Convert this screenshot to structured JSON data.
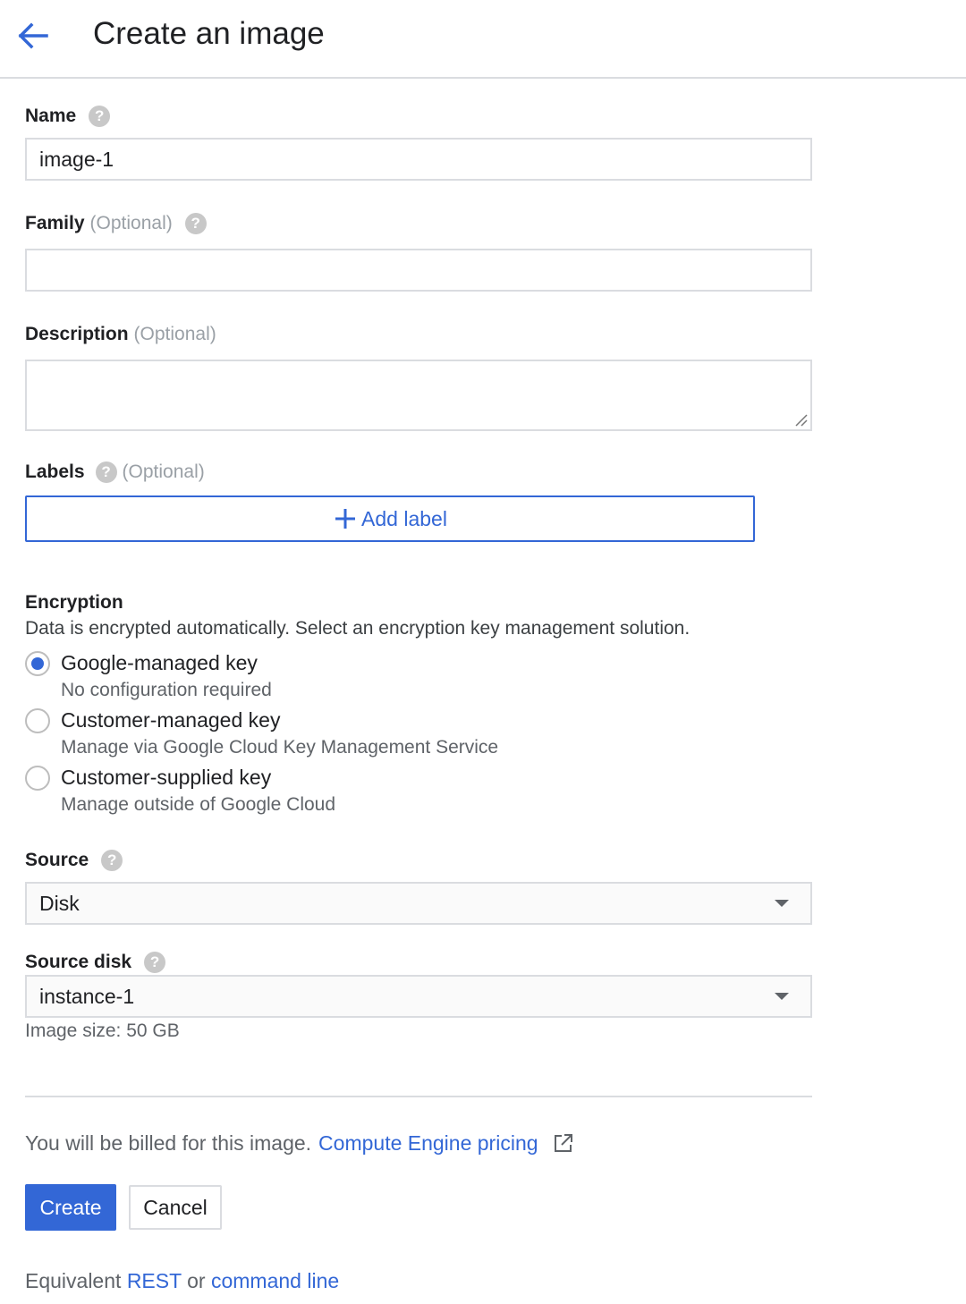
{
  "header": {
    "title": "Create an image",
    "back_icon": "arrow-back-icon"
  },
  "form": {
    "name": {
      "label": "Name",
      "value": "image-1"
    },
    "family": {
      "label": "Family",
      "optional": "(Optional)",
      "value": ""
    },
    "description": {
      "label": "Description",
      "optional": "(Optional)",
      "value": ""
    },
    "labels": {
      "label": "Labels",
      "optional": "(Optional)",
      "add_button": "Add label"
    },
    "help_glyph": "?",
    "encryption": {
      "title": "Encryption",
      "description": "Data is encrypted automatically. Select an encryption key management solution.",
      "options": [
        {
          "label": "Google-managed key",
          "sub": "No configuration required",
          "checked": true
        },
        {
          "label": "Customer-managed key",
          "sub": "Manage via Google Cloud Key Management Service",
          "checked": false
        },
        {
          "label": "Customer-supplied key",
          "sub": "Manage outside of Google Cloud",
          "checked": false
        }
      ]
    },
    "source": {
      "label": "Source",
      "value": "Disk"
    },
    "source_disk": {
      "label": "Source disk",
      "value": "instance-1",
      "image_size": "Image size: 50 GB"
    }
  },
  "footer": {
    "billing_text": "You will be billed for this image.",
    "pricing_link": "Compute Engine pricing",
    "create_label": "Create",
    "cancel_label": "Cancel",
    "equiv_prefix": "Equivalent",
    "rest_link": "REST",
    "equiv_or": "or",
    "cli_link": "command line"
  },
  "colors": {
    "accent": "#3367d6",
    "border": "#dadce0"
  }
}
